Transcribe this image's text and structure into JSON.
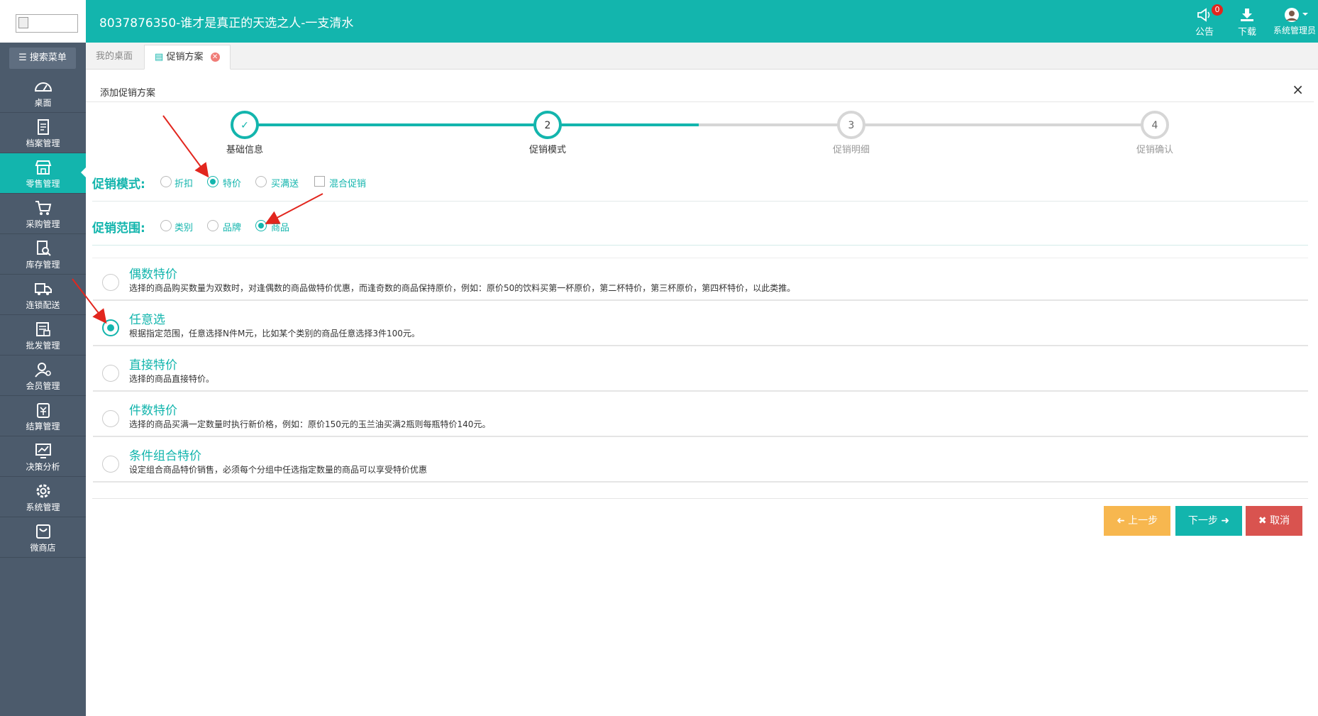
{
  "header": {
    "title": "8037876350-谁才是真正的天选之人-一支清水",
    "announce_label": "公告",
    "announce_badge": "0",
    "download_label": "下载",
    "user_label": "系统管理员"
  },
  "sidebar": {
    "search_label": "搜索菜单",
    "items": [
      {
        "label": "桌面",
        "icon": "dashboard-icon"
      },
      {
        "label": "档案管理",
        "icon": "file-icon"
      },
      {
        "label": "零售管理",
        "icon": "store-icon",
        "active": true
      },
      {
        "label": "采购管理",
        "icon": "cart-icon"
      },
      {
        "label": "库存管理",
        "icon": "inventory-search-icon"
      },
      {
        "label": "连锁配送",
        "icon": "truck-icon"
      },
      {
        "label": "批发管理",
        "icon": "wholesale-icon"
      },
      {
        "label": "会员管理",
        "icon": "member-icon"
      },
      {
        "label": "结算管理",
        "icon": "settlement-icon"
      },
      {
        "label": "决策分析",
        "icon": "chart-icon"
      },
      {
        "label": "系统管理",
        "icon": "gear-icon"
      },
      {
        "label": "微商店",
        "icon": "shop-bag-icon"
      }
    ]
  },
  "tabs": [
    {
      "label": "我的桌面"
    },
    {
      "label": "促销方案",
      "active": true
    }
  ],
  "panel": {
    "title": "添加促销方案",
    "close": "×"
  },
  "steps": [
    {
      "number": "✓",
      "label": "基础信息",
      "state": "done"
    },
    {
      "number": "2",
      "label": "促销模式",
      "state": "current"
    },
    {
      "number": "3",
      "label": "促销明细",
      "state": "pending"
    },
    {
      "number": "4",
      "label": "促销确认",
      "state": "pending"
    }
  ],
  "promo_mode": {
    "label": "促销模式:",
    "options": [
      {
        "label": "折扣",
        "checked": false
      },
      {
        "label": "特价",
        "checked": true
      },
      {
        "label": "买满送",
        "checked": false
      },
      {
        "label": "混合促销",
        "checked": false,
        "type": "checkbox"
      }
    ]
  },
  "promo_scope": {
    "label": "促销范围:",
    "options": [
      {
        "label": "类别",
        "checked": false
      },
      {
        "label": "品牌",
        "checked": false
      },
      {
        "label": "商品",
        "checked": true
      }
    ]
  },
  "modes": [
    {
      "title": "偶数特价",
      "desc": "选择的商品购买数量为双数时，对逢偶数的商品做特价优惠，而逢奇数的商品保持原价，例如：原价50的饮料买第一杯原价，第二杯特价，第三杯原价，第四杯特价，以此类推。",
      "selected": false
    },
    {
      "title": "任意选",
      "desc": "根据指定范围，任意选择N件M元，比如某个类别的商品任意选择3件100元。",
      "selected": true
    },
    {
      "title": "直接特价",
      "desc": "选择的商品直接特价。",
      "selected": false
    },
    {
      "title": "件数特价",
      "desc": "选择的商品买满一定数量时执行新价格，例如：原价150元的玉兰油买满2瓶则每瓶特价140元。",
      "selected": false
    },
    {
      "title": "条件组合特价",
      "desc": "设定组合商品特价销售，必须每个分组中任选指定数量的商品可以享受特价优惠",
      "selected": false
    }
  ],
  "buttons": {
    "prev": "上一步",
    "next": "下一步",
    "cancel": "取消"
  },
  "colors": {
    "accent": "#13b5ad",
    "sidebar": "#4c5b6c",
    "prev": "#f7b74f",
    "cancel": "#d9534f",
    "annotation": "#e2261e"
  }
}
